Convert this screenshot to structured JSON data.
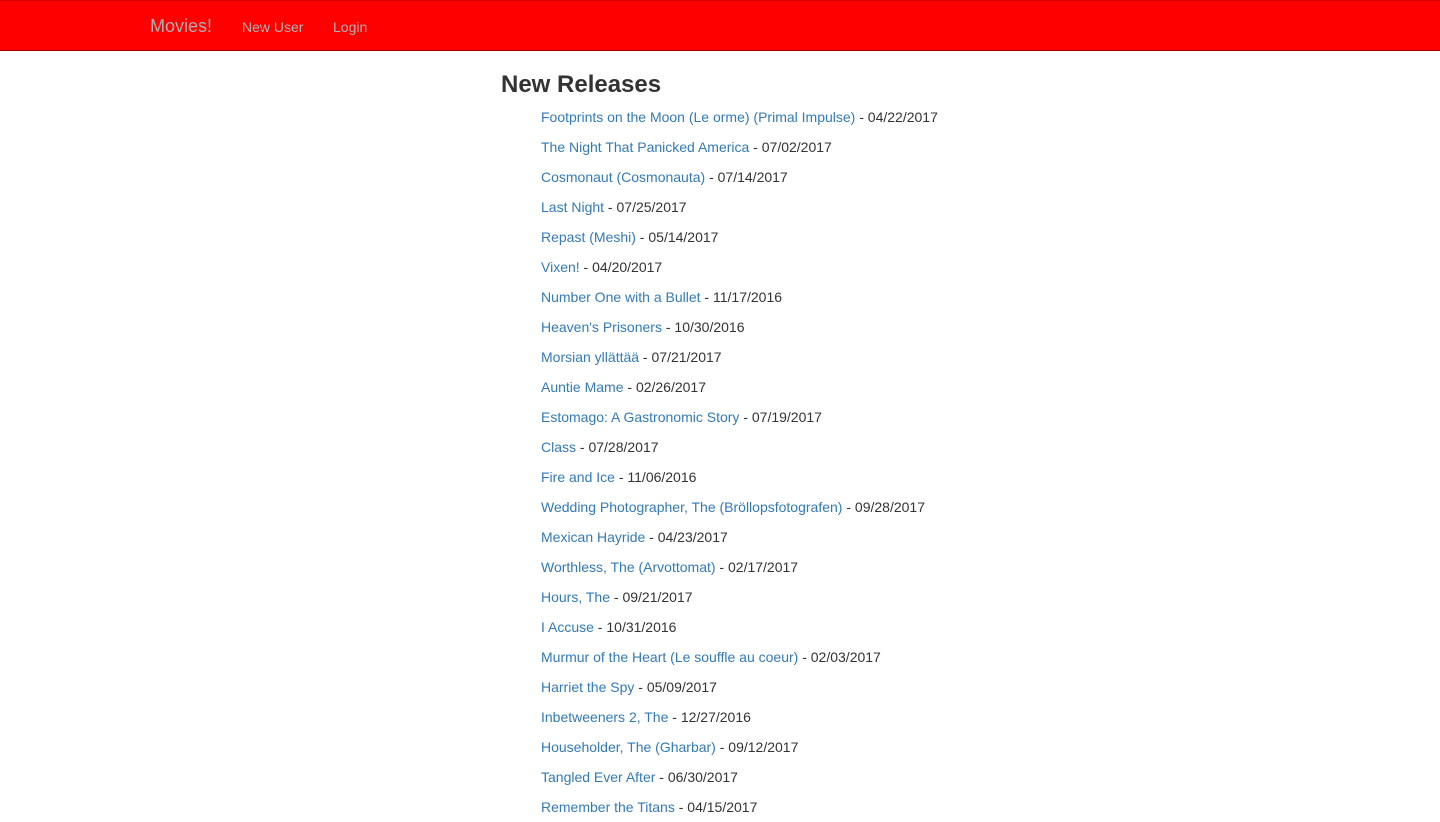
{
  "navbar": {
    "brand": "Movies!",
    "links": [
      {
        "label": "New User"
      },
      {
        "label": "Login"
      }
    ],
    "background_color": "#ff0000",
    "link_color": "#b3b3b3"
  },
  "main": {
    "title": "New Releases",
    "link_color": "#337ab7",
    "separator": " - ",
    "releases": [
      {
        "title": "Footprints on the Moon (Le orme) (Primal Impulse)",
        "date": "04/22/2017"
      },
      {
        "title": "The Night That Panicked America",
        "date": "07/02/2017"
      },
      {
        "title": "Cosmonaut (Cosmonauta)",
        "date": "07/14/2017"
      },
      {
        "title": "Last Night",
        "date": "07/25/2017"
      },
      {
        "title": "Repast (Meshi)",
        "date": "05/14/2017"
      },
      {
        "title": "Vixen!",
        "date": "04/20/2017"
      },
      {
        "title": "Number One with a Bullet",
        "date": "11/17/2016"
      },
      {
        "title": "Heaven's Prisoners",
        "date": "10/30/2016"
      },
      {
        "title": "Morsian yllättää",
        "date": "07/21/2017"
      },
      {
        "title": "Auntie Mame",
        "date": "02/26/2017"
      },
      {
        "title": "Estomago: A Gastronomic Story",
        "date": "07/19/2017"
      },
      {
        "title": "Class",
        "date": "07/28/2017"
      },
      {
        "title": "Fire and Ice",
        "date": "11/06/2016"
      },
      {
        "title": "Wedding Photographer, The (Bröllopsfotografen)",
        "date": "09/28/2017"
      },
      {
        "title": "Mexican Hayride",
        "date": "04/23/2017"
      },
      {
        "title": "Worthless, The (Arvottomat)",
        "date": "02/17/2017"
      },
      {
        "title": "Hours, The",
        "date": "09/21/2017"
      },
      {
        "title": "I Accuse",
        "date": "10/31/2016"
      },
      {
        "title": "Murmur of the Heart (Le souffle au coeur)",
        "date": "02/03/2017"
      },
      {
        "title": "Harriet the Spy",
        "date": "05/09/2017"
      },
      {
        "title": "Inbetweeners 2, The",
        "date": "12/27/2016"
      },
      {
        "title": "Householder, The (Gharbar)",
        "date": "09/12/2017"
      },
      {
        "title": "Tangled Ever After",
        "date": "06/30/2017"
      },
      {
        "title": "Remember the Titans",
        "date": "04/15/2017"
      }
    ]
  }
}
